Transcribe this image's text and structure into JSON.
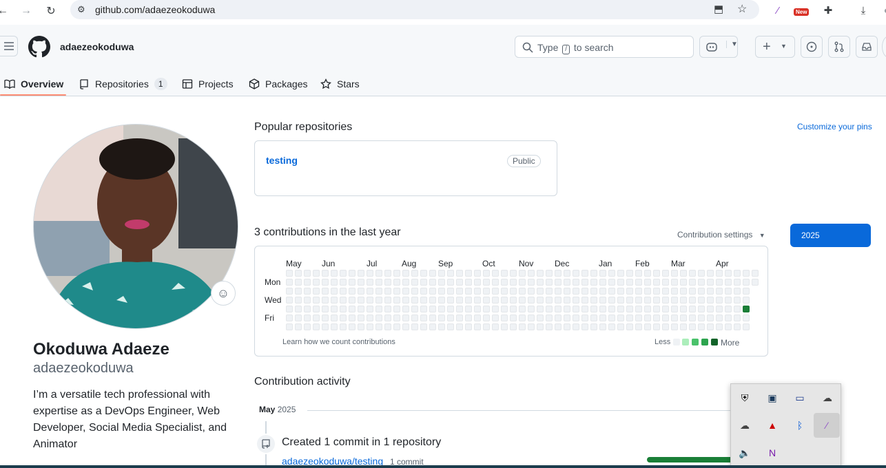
{
  "browser": {
    "url": "github.com/adaezeokoduwa",
    "new_badge": "New"
  },
  "header": {
    "username": "adaezeokoduwa",
    "search_prefix": "Type",
    "search_key": "/",
    "search_suffix": "to search"
  },
  "tabs": [
    {
      "label": "Overview",
      "icon": "book-icon",
      "active": true
    },
    {
      "label": "Repositories",
      "icon": "repo-icon",
      "count": "1"
    },
    {
      "label": "Projects",
      "icon": "table-icon"
    },
    {
      "label": "Packages",
      "icon": "package-icon"
    },
    {
      "label": "Stars",
      "icon": "star-icon"
    }
  ],
  "profile": {
    "full_name": "Okoduwa Adaeze",
    "username": "adaezeokoduwa",
    "bio": "I’m a versatile tech professional with expertise as a DevOps Engineer, Web Developer, Social Media Specialist, and Animator"
  },
  "popular": {
    "title": "Popular repositories",
    "customize": "Customize your pins",
    "repo_name": "testing",
    "visibility": "Public"
  },
  "contributions": {
    "title": "3 contributions in the last year",
    "settings": "Contribution settings",
    "year": "2025",
    "months": [
      "May",
      "Jun",
      "Jul",
      "Aug",
      "Sep",
      "Oct",
      "Nov",
      "Dec",
      "Jan",
      "Feb",
      "Mar",
      "Apr"
    ],
    "days": [
      "Mon",
      "Wed",
      "Fri"
    ],
    "learn": "Learn how we count contributions",
    "less": "Less",
    "more": "More",
    "legend_colors": [
      "#eff2f5",
      "#aceebb",
      "#4ac26b",
      "#2da44e",
      "#116329"
    ],
    "active_color": "#1a7f37"
  },
  "activity": {
    "title": "Contribution activity",
    "month": "May",
    "year": "2025",
    "event_title": "Created 1 commit in 1 repository",
    "repo": "adaezeokoduwa/testing",
    "commit_count": "1 commit"
  },
  "colors": {
    "link": "#0969da",
    "primary_button": "#0969da",
    "tab_underline": "#fd8c73"
  }
}
